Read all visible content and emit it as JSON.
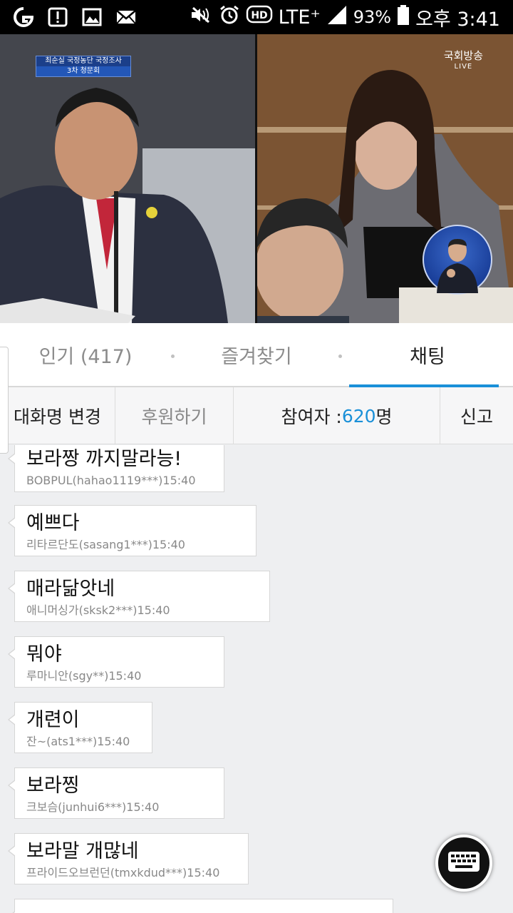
{
  "status_bar": {
    "lte": "LTE⁺",
    "battery_pct": "93%",
    "time": "오후 3:41",
    "icons": [
      "app-icon",
      "alert-icon",
      "image-icon",
      "mail-icon",
      "mute-icon",
      "alarm-icon",
      "hd-icon",
      "signal-icon",
      "battery-icon"
    ]
  },
  "video": {
    "caption_line1": "최순실 국정농단 국정조사",
    "caption_line2": "3차 청문회",
    "channel_name": "국회방송",
    "channel_live": "LIVE"
  },
  "tabs": [
    {
      "label": "인기 (417)",
      "active": false
    },
    {
      "label": "즐겨찾기",
      "active": false
    },
    {
      "label": "채팅",
      "active": true
    }
  ],
  "toolbar": {
    "rename_label": "대화명 변경",
    "donate_label": "후원하기",
    "participants_prefix": "참여자 : ",
    "participants_count": "620",
    "participants_suffix": "명",
    "report_label": "신고"
  },
  "accent_color": "#1a90d8",
  "messages": [
    {
      "text": "보라짱 까지말라능!",
      "meta": "BOBPUL(hahao1119***)15:40"
    },
    {
      "text": "예쁘다",
      "meta": "리타르단도(sasang1***)15:40"
    },
    {
      "text": "매라닮앗네",
      "meta": "애니머싱가(sksk2***)15:40"
    },
    {
      "text": "뭐야",
      "meta": "루마니안(sgy**)15:40"
    },
    {
      "text": "개련이",
      "meta": "잔~(ats1***)15:40"
    },
    {
      "text": "보라찡",
      "meta": "크보슴(junhui6***)15:40"
    },
    {
      "text": "보라말 개많네",
      "meta": "프라이드오브런던(tmxkdud***)15:40"
    }
  ]
}
